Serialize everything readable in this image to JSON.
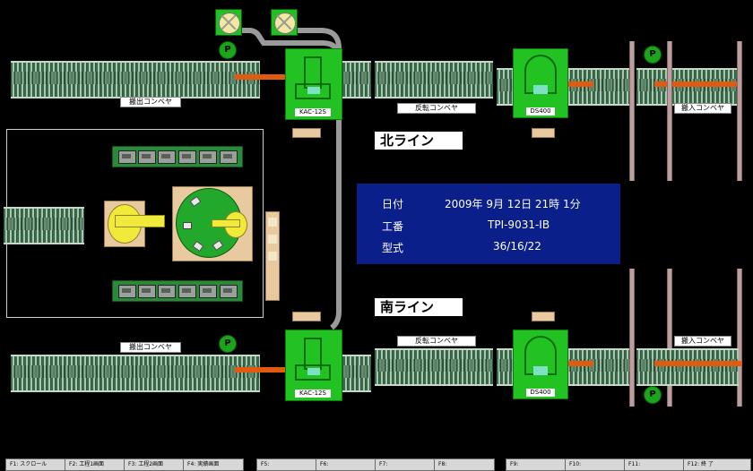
{
  "lines": {
    "north": {
      "title": "北ライン"
    },
    "south": {
      "title": "南ライン"
    }
  },
  "conveyors": {
    "unload": "搬出コンベヤ",
    "reverse": "反転コンベヤ",
    "load": "搬入コンベヤ"
  },
  "machines": {
    "kac": "KAC-12S",
    "ds": "DS400"
  },
  "badge": "P",
  "info": {
    "date_label": "日付",
    "date_value": "2009年 9月 12日 21時 1分",
    "job_label": "工番",
    "job_value": "TPI-9031-IB",
    "model_label": "型式",
    "model_value": "36/16/22"
  },
  "fkeys": [
    "F1: スクロール",
    "F2: 工程1画面",
    "F3: 工程2画面",
    "F4: 実績画面",
    "F5:",
    "F6:",
    "F7:",
    "F8:",
    "F9:",
    "F10:",
    "F11:",
    "F12: 終 了"
  ],
  "colors": {
    "background": "#000000",
    "machine": "#22c222",
    "rod": "#e05a10",
    "info_panel": "#0b1f8a"
  }
}
